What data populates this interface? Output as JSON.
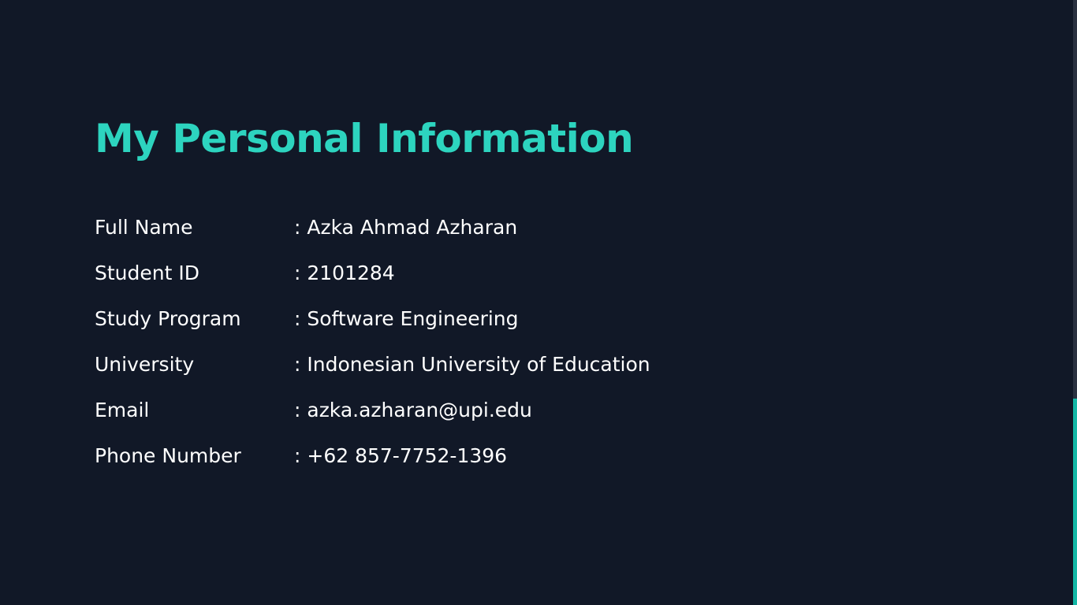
{
  "page": {
    "title": "My Personal Information",
    "accent_color": "#2dd4bf",
    "background_color": "#111827",
    "text_color": "#ffffff"
  },
  "info": {
    "rows": [
      {
        "label": "Full Name",
        "value": ": Azka Ahmad Azharan"
      },
      {
        "label": "Student ID",
        "value": ": 2101284"
      },
      {
        "label": "Study Program",
        "value": ": Software Engineering"
      },
      {
        "label": "University",
        "value": ": Indonesian University of Education"
      },
      {
        "label": "Email",
        "value": ": azka.azharan@upi.edu"
      },
      {
        "label": "Phone Number",
        "value": ": +62 857-7752-1396"
      }
    ]
  },
  "scrollbar": {
    "position_fraction": 0.66,
    "thumb_color": "#14b8a6"
  }
}
